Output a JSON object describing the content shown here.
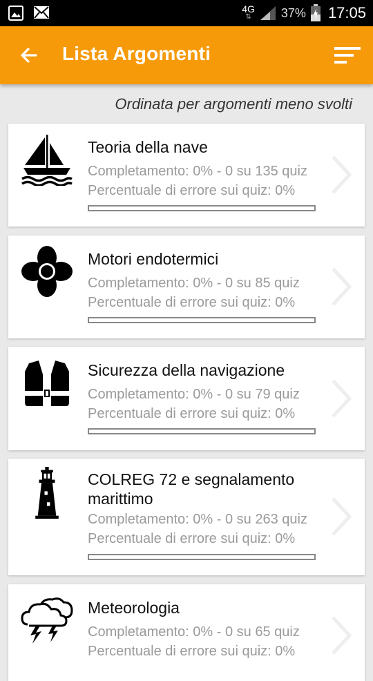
{
  "status_bar": {
    "network": "4G",
    "network_arrows": "⇅",
    "battery_percent": "37%",
    "time": "17:05",
    "icons": [
      "image-icon",
      "mail-icon",
      "signal-icon",
      "battery-icon"
    ]
  },
  "app_bar": {
    "title": "Lista Argomenti",
    "back_icon": "arrow-left-icon",
    "sort_icon": "sort-icon",
    "color": "#f69a0a"
  },
  "subtitle": "Ordinata per argomenti meno svolti",
  "topics": [
    {
      "icon": "sailboat-icon",
      "title": "Teoria della nave",
      "completion": "Completamento: 0% - 0 su 135 quiz",
      "error_rate": "Percentuale di errore sui quiz: 0%",
      "progress": 0
    },
    {
      "icon": "propeller-icon",
      "title": "Motori endotermici",
      "completion": "Completamento: 0% - 0 su 85 quiz",
      "error_rate": "Percentuale di errore sui quiz: 0%",
      "progress": 0
    },
    {
      "icon": "life-vest-icon",
      "title": "Sicurezza della navigazione",
      "completion": "Completamento: 0% - 0 su 79 quiz",
      "error_rate": "Percentuale di errore sui quiz: 0%",
      "progress": 0
    },
    {
      "icon": "lighthouse-icon",
      "title": "COLREG 72 e segnalamento marittimo",
      "completion": "Completamento: 0% - 0 su 263 quiz",
      "error_rate": "Percentuale di errore sui quiz: 0%",
      "progress": 0
    },
    {
      "icon": "storm-cloud-icon",
      "title": "Meteorologia",
      "completion": "Completamento: 0% - 0 su 65 quiz",
      "error_rate": "Percentuale di errore sui quiz: 0%",
      "progress": 0
    }
  ]
}
